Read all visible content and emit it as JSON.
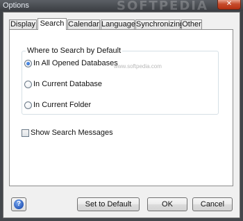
{
  "window": {
    "title": "Options",
    "watermark": "SOFTPEDIA",
    "small_watermark": "www.softpedia.com",
    "close_glyph": "✕"
  },
  "tabs": [
    {
      "label": "Display",
      "active": false
    },
    {
      "label": "Search",
      "active": true
    },
    {
      "label": "Calendar",
      "active": false
    },
    {
      "label": "Language",
      "active": false
    },
    {
      "label": "Synchronizing",
      "active": false
    },
    {
      "label": "Other",
      "active": false
    }
  ],
  "search_panel": {
    "group_title": "Where to Search by Default",
    "options": [
      {
        "label": "In All Opened Databases",
        "checked": true
      },
      {
        "label": "In Current Database",
        "checked": false
      },
      {
        "label": "In Current Folder",
        "checked": false
      }
    ],
    "show_messages": {
      "label": "Show Search Messages",
      "checked": false
    }
  },
  "buttons": {
    "help_glyph": "?",
    "set_default": "Set to Default",
    "ok": "OK",
    "cancel": "Cancel"
  },
  "colors": {
    "frame": "#3f4247",
    "close": "#c64b2b",
    "panel": "#ffffff",
    "radio_dot": "#1b4fa8"
  }
}
